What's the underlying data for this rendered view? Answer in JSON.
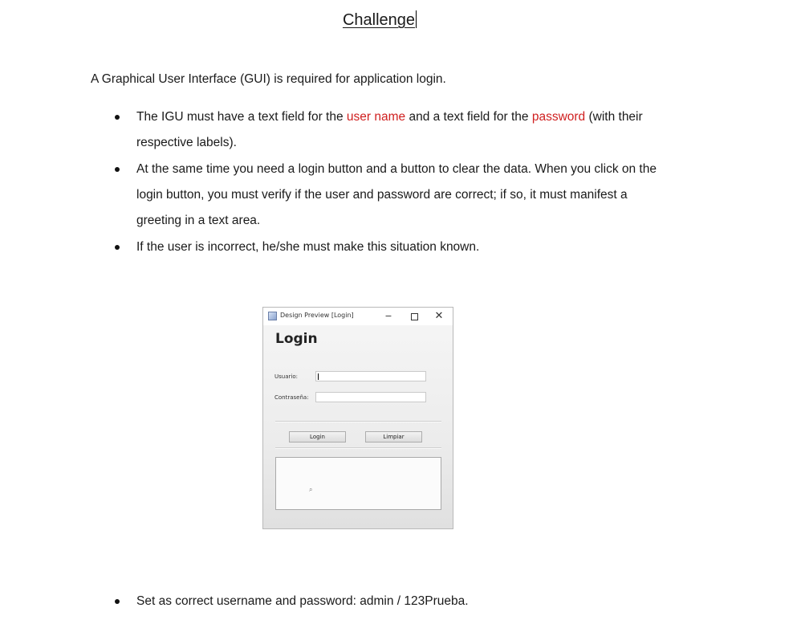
{
  "document": {
    "title": "Challenge",
    "intro": "A Graphical User Interface (GUI) is required for application login.",
    "bullets": [
      {
        "seg0": "The IGU must have a text field for the ",
        "seg1": "user name",
        "seg2": " and a text field for the ",
        "seg3": "password",
        "seg4": " (with their respective labels)."
      },
      {
        "text": "At the same time you need a login button and a button to clear the data. When you click on the login button, you must verify if the user and password are correct; if so, it must manifest a greeting in a text area."
      },
      {
        "text": "If the user is incorrect, he/she must make this situation known."
      },
      {
        "text": "Set as correct username and password: admin / 123Prueba."
      }
    ],
    "highlight_color": "#d02020"
  },
  "preview_window": {
    "title": "Design Preview [Login]",
    "minimize_glyph": "−",
    "close_glyph": "✕",
    "heading": "Login",
    "usuario_label": "Usuario:",
    "contrasena_label": "Contraseña:",
    "usuario_value": "",
    "contrasena_value": "",
    "login_button": "Login",
    "limpiar_button": "Limpiar",
    "output_text": "",
    "icons": [
      "window-app-icon",
      "minimize-icon",
      "maximize-icon",
      "close-icon",
      "mouse-pointer-icon"
    ]
  }
}
